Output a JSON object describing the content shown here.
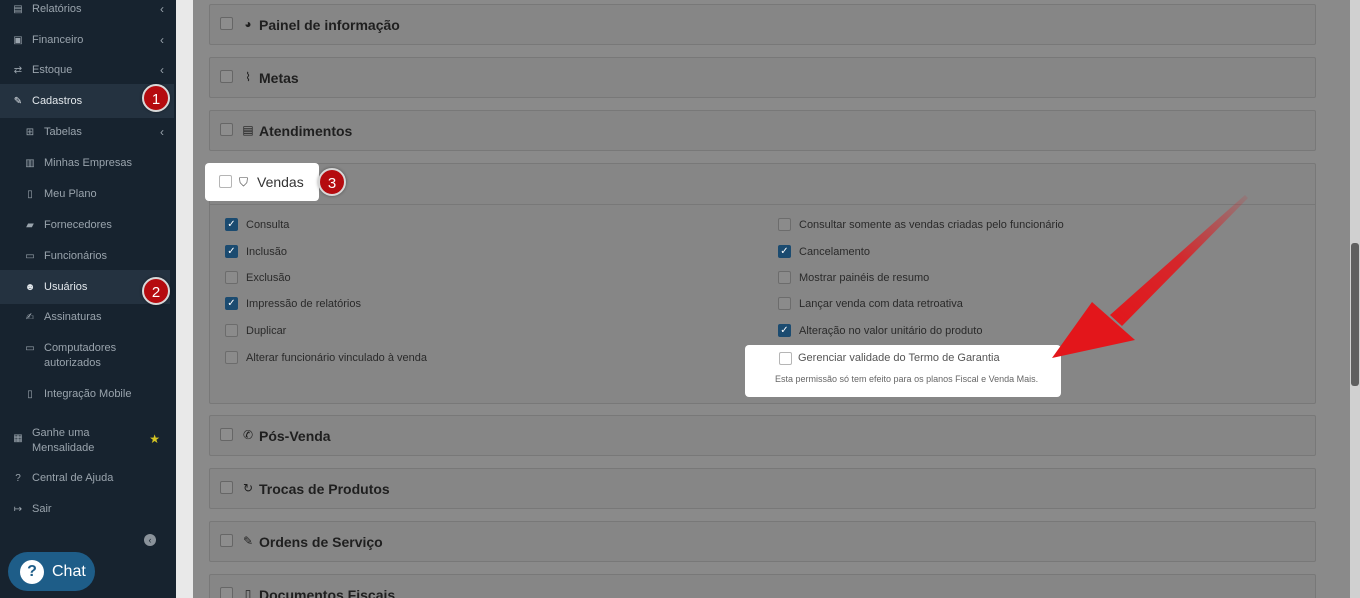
{
  "sidebar": {
    "items": [
      {
        "label": "Relatórios",
        "icon": "report-icon"
      },
      {
        "label": "Financeiro",
        "icon": "money-icon"
      },
      {
        "label": "Estoque",
        "icon": "exchange-icon"
      },
      {
        "label": "Cadastros",
        "icon": "edit-icon"
      },
      {
        "label": "Tabelas",
        "icon": "table-icon"
      },
      {
        "label": "Minhas Empresas",
        "icon": "building-icon"
      },
      {
        "label": "Meu Plano",
        "icon": "file-icon"
      },
      {
        "label": "Fornecedores",
        "icon": "truck-icon"
      },
      {
        "label": "Funcionários",
        "icon": "folder-icon"
      },
      {
        "label": "Usuários",
        "icon": "users-icon"
      },
      {
        "label": "Assinaturas",
        "icon": "signature-icon"
      },
      {
        "label": "Computadores autorizados",
        "icon": "desktop-icon"
      },
      {
        "label": "Integração Mobile",
        "icon": "mobile-icon"
      },
      {
        "label": "Ganhe uma Mensalidade",
        "icon": "gift-icon"
      },
      {
        "label": "Central de Ajuda",
        "icon": "help-icon"
      },
      {
        "label": "Sair",
        "icon": "logout-icon"
      }
    ],
    "chat_label": "Chat"
  },
  "badges": {
    "one": "1",
    "two": "2",
    "three": "3"
  },
  "panels": {
    "painel": "Painel de informação",
    "metas": "Metas",
    "atendimentos": "Atendimentos",
    "vendas": "Vendas",
    "pos_venda": "Pós-Venda",
    "trocas": "Trocas de Produtos",
    "ordens": "Ordens de Serviço",
    "documentos": "Documentos Fiscais"
  },
  "permissions": {
    "left": [
      {
        "label": "Consulta",
        "checked": true
      },
      {
        "label": "Inclusão",
        "checked": true
      },
      {
        "label": "Exclusão",
        "checked": false
      },
      {
        "label": "Impressão de relatórios",
        "checked": true
      },
      {
        "label": "Duplicar",
        "checked": false
      },
      {
        "label": "Alterar funcionário vinculado à venda",
        "checked": false
      }
    ],
    "right": [
      {
        "label": "Consultar somente as vendas criadas pelo funcionário",
        "checked": false
      },
      {
        "label": "Cancelamento",
        "checked": true
      },
      {
        "label": "Mostrar painéis de resumo",
        "checked": false
      },
      {
        "label": "Lançar venda com data retroativa",
        "checked": false
      },
      {
        "label": "Alteração no valor unitário do produto",
        "checked": true
      }
    ],
    "garantia_label": "Gerenciar validade do Termo de Garantia",
    "garantia_note": "Esta permissão só tem efeito para os planos Fiscal e Venda Mais."
  },
  "colors": {
    "sidebar_bg": "#17232f",
    "badge_red": "#b50b0f",
    "arrow_red": "#e3161b",
    "check_blue": "#1b4b70"
  }
}
